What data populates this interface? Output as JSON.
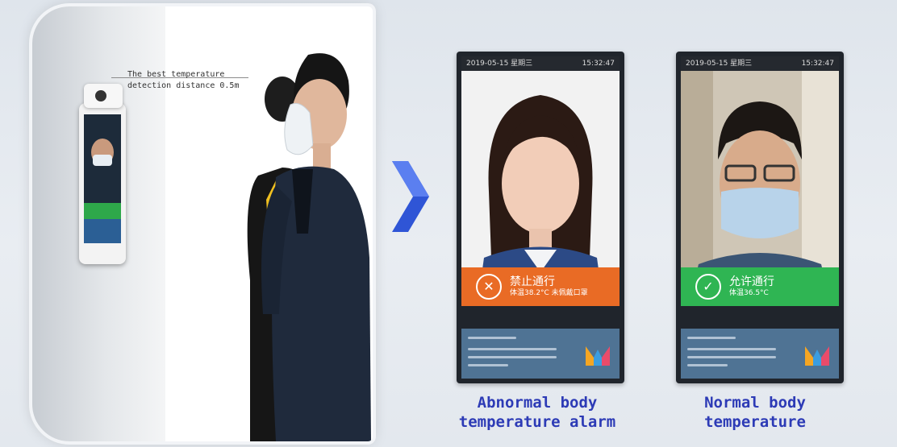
{
  "illustration": {
    "distance_label": "The best temperature\ndetection distance 0.5m"
  },
  "screens": [
    {
      "status_left": "2019-05-15 星期三",
      "status_right": "15:32:47",
      "banner_title": "禁止通行",
      "banner_sub": "体温38.2°C 未佩戴口罩",
      "banner_color": "#e96b25",
      "banner_icon": "x-circle-icon",
      "caption": "Abnormal body\ntemperature alarm"
    },
    {
      "status_left": "2019-05-15 星期三",
      "status_right": "15:32:47",
      "banner_title": "允许通行",
      "banner_sub": "体温36.5°C",
      "banner_color": "#2fb553",
      "banner_icon": "check-circle-icon",
      "caption": "Normal body\ntemperature"
    }
  ],
  "colors": {
    "caption": "#2d3bb6",
    "arrow": "#2f55d6"
  }
}
